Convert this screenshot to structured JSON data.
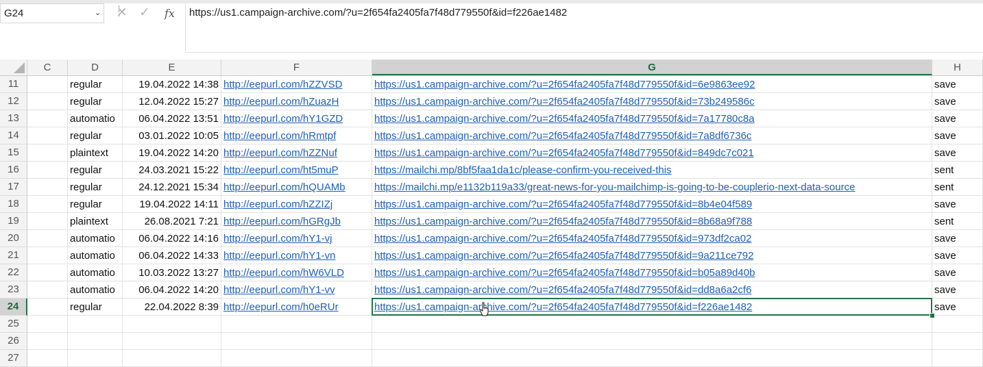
{
  "name_box": "G24",
  "formula": "https://us1.campaign-archive.com/?u=2f654fa2405fa7f48d779550f&id=f226ae1482",
  "formula_icons": [
    "cancel-icon",
    "enter-icon",
    "function-icon"
  ],
  "columns": [
    "C",
    "D",
    "E",
    "F",
    "G",
    "H"
  ],
  "selected_column": "G",
  "selected_row": "24",
  "rows": [
    {
      "num": "11",
      "D": "regular",
      "E": "19.04.2022 14:38",
      "F": "http://eepurl.com/hZZVSD",
      "G": "https://us1.campaign-archive.com/?u=2f654fa2405fa7f48d779550f&id=6e9863ee92",
      "H": "save"
    },
    {
      "num": "12",
      "D": "regular",
      "E": "12.04.2022 15:27",
      "F": "http://eepurl.com/hZuazH",
      "G": "https://us1.campaign-archive.com/?u=2f654fa2405fa7f48d779550f&id=73b249586c",
      "H": "save"
    },
    {
      "num": "13",
      "D": "automatio",
      "E": "06.04.2022 13:51",
      "F": "http://eepurl.com/hY1GZD",
      "G": "https://us1.campaign-archive.com/?u=2f654fa2405fa7f48d779550f&id=7a17780c8a",
      "H": "save"
    },
    {
      "num": "14",
      "D": "regular",
      "E": "03.01.2022 10:05",
      "F": "http://eepurl.com/hRmtpf",
      "G": "https://us1.campaign-archive.com/?u=2f654fa2405fa7f48d779550f&id=7a8df6736c",
      "H": "save"
    },
    {
      "num": "15",
      "D": "plaintext",
      "E": "19.04.2022 14:20",
      "F": "http://eepurl.com/hZZNuf",
      "G": "https://us1.campaign-archive.com/?u=2f654fa2405fa7f48d779550f&id=849dc7c021",
      "H": "save"
    },
    {
      "num": "16",
      "D": "regular",
      "E": "24.03.2021 15:22",
      "F": "http://eepurl.com/ht5muP",
      "G": "https://mailchi.mp/8bf5faa1da1c/please-confirm-you-received-this",
      "H": "sent"
    },
    {
      "num": "17",
      "D": "regular",
      "E": "24.12.2021 15:34",
      "F": "http://eepurl.com/hQUAMb",
      "G": "https://mailchi.mp/e1132b119a33/great-news-for-you-mailchimp-is-going-to-be-couplerio-next-data-source",
      "H": "sent"
    },
    {
      "num": "18",
      "D": "regular",
      "E": "19.04.2022 14:11",
      "F": "http://eepurl.com/hZZIZj",
      "G": "https://us1.campaign-archive.com/?u=2f654fa2405fa7f48d779550f&id=8b4e04f589",
      "H": "save"
    },
    {
      "num": "19",
      "D": "plaintext",
      "E": "26.08.2021 7:21",
      "F": "http://eepurl.com/hGRgJb",
      "G": "https://us1.campaign-archive.com/?u=2f654fa2405fa7f48d779550f&id=8b68a9f788",
      "H": "sent"
    },
    {
      "num": "20",
      "D": "automatio",
      "E": "06.04.2022 14:16",
      "F": "http://eepurl.com/hY1-vj",
      "G": "https://us1.campaign-archive.com/?u=2f654fa2405fa7f48d779550f&id=973df2ca02",
      "H": "save"
    },
    {
      "num": "21",
      "D": "automatio",
      "E": "06.04.2022 14:33",
      "F": "http://eepurl.com/hY1-vn",
      "G": "https://us1.campaign-archive.com/?u=2f654fa2405fa7f48d779550f&id=9a211ce792",
      "H": "save"
    },
    {
      "num": "22",
      "D": "automatio",
      "E": "10.03.2022 13:27",
      "F": "http://eepurl.com/hW6VLD",
      "G": "https://us1.campaign-archive.com/?u=2f654fa2405fa7f48d779550f&id=b05a89d40b",
      "H": "save"
    },
    {
      "num": "23",
      "D": "automatio",
      "E": "06.04.2022 14:20",
      "F": "http://eepurl.com/hY1-vv",
      "G": "https://us1.campaign-archive.com/?u=2f654fa2405fa7f48d779550f&id=dd8a6a2cf6",
      "H": "save"
    },
    {
      "num": "24",
      "D": "regular",
      "E": "22.04.2022 8:39",
      "F": "http://eepurl.com/h0eRUr",
      "G": "https://us1.campaign-archive.com/?u=2f654fa2405fa7f48d779550f&id=f226ae1482",
      "H": "save"
    },
    {
      "num": "25",
      "D": "",
      "E": "",
      "F": "",
      "G": "",
      "H": ""
    },
    {
      "num": "26",
      "D": "",
      "E": "",
      "F": "",
      "G": "",
      "H": ""
    },
    {
      "num": "27",
      "D": "",
      "E": "",
      "F": "",
      "G": "",
      "H": ""
    }
  ],
  "colors": {
    "accent": "#217346",
    "link": "#1f5fb3",
    "header_bg": "#f3f3f3",
    "selected_header_bg": "#d2d2d2"
  }
}
